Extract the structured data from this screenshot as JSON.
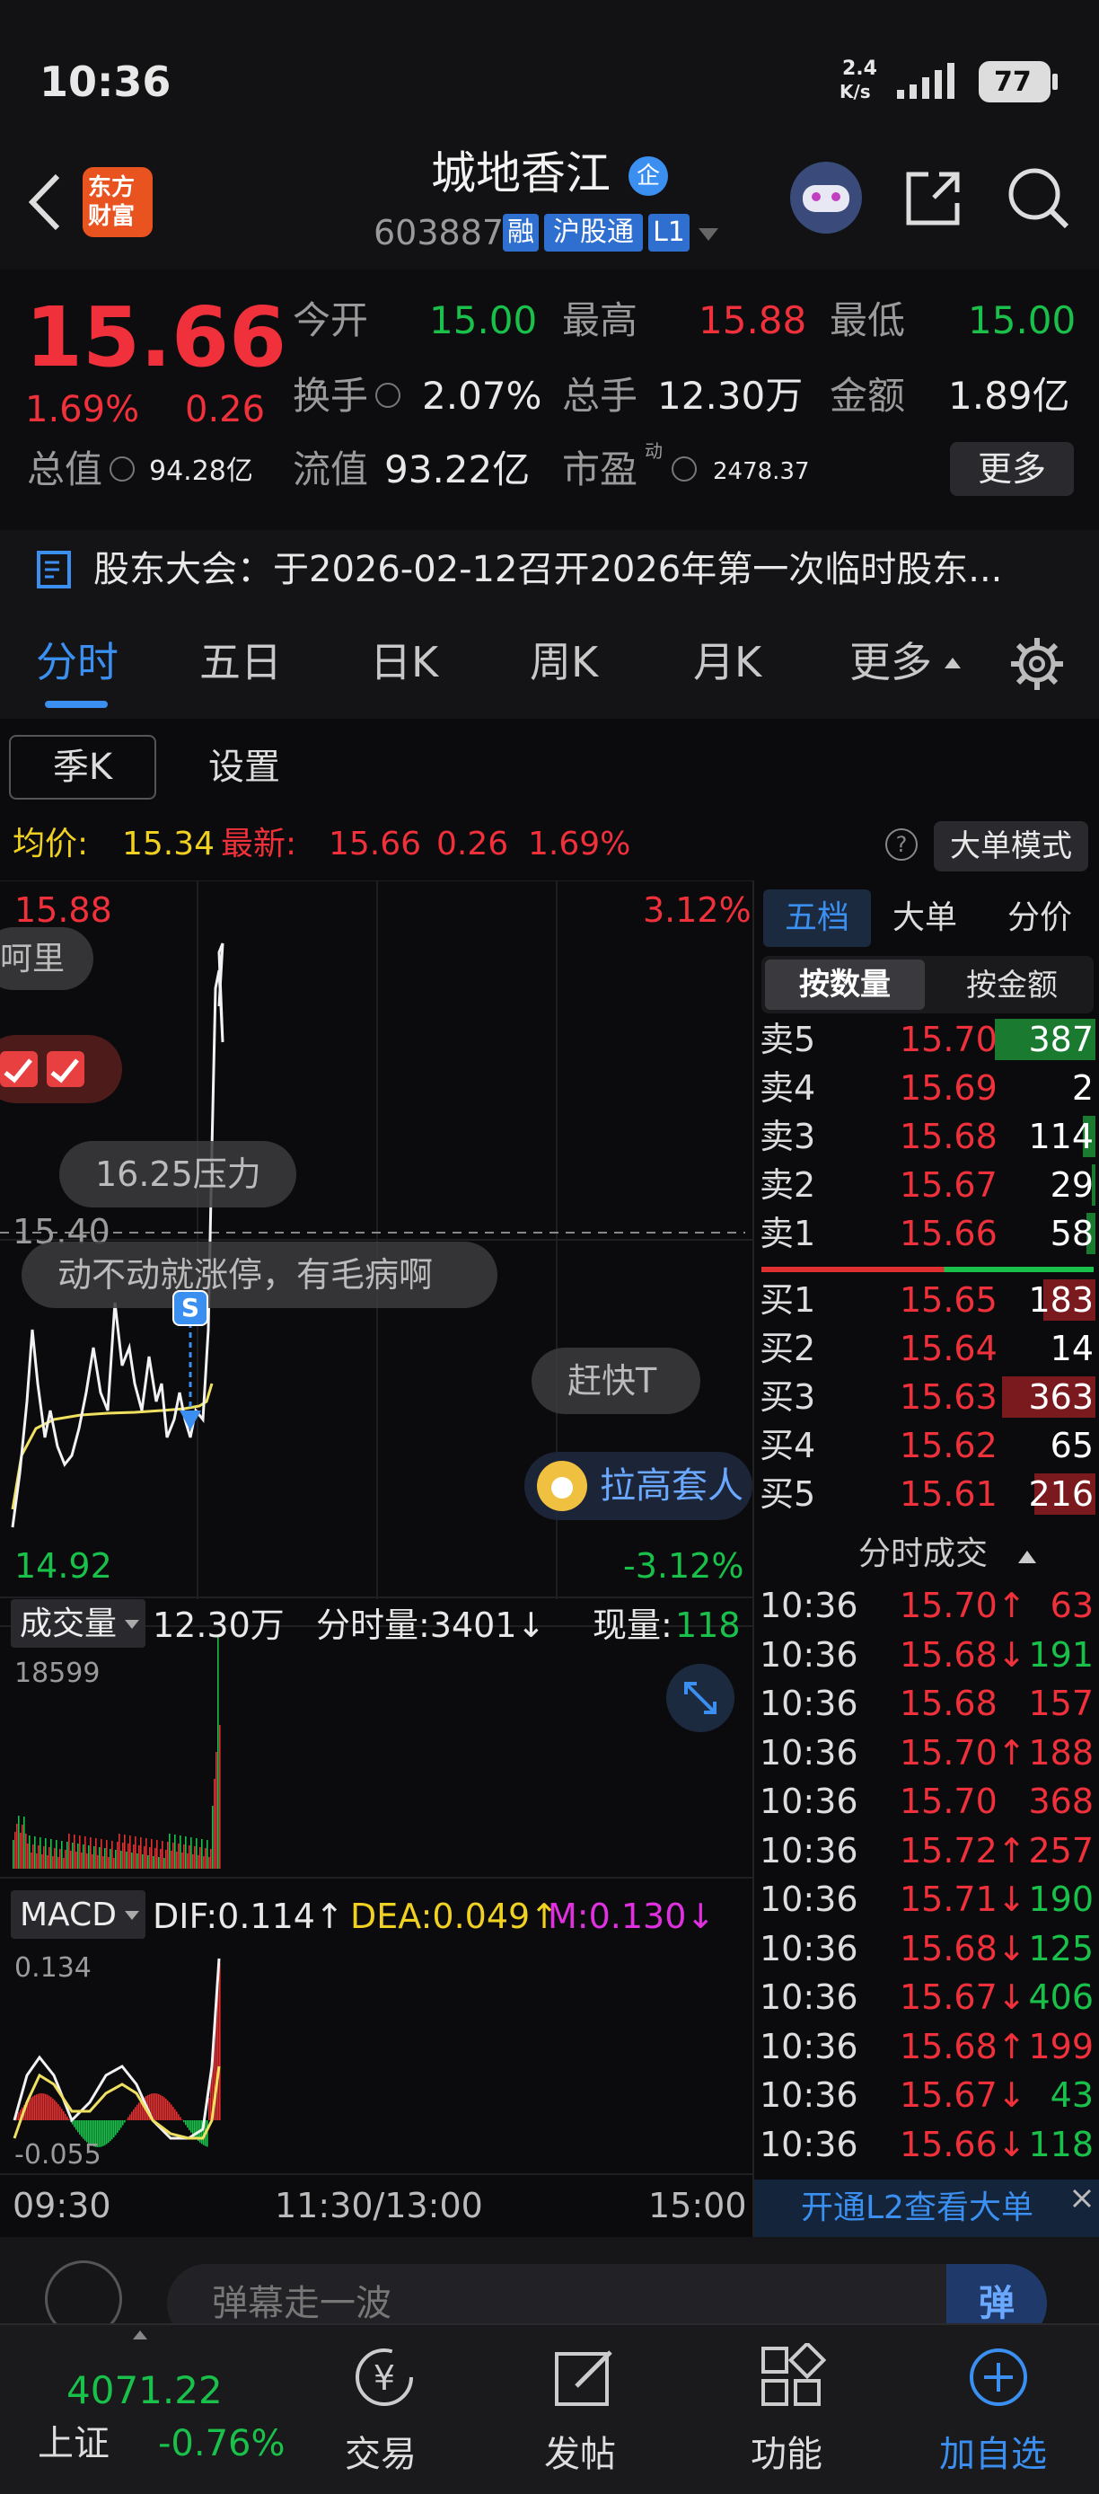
{
  "status": {
    "time": "10:36",
    "net_speed_top": "2.4",
    "net_speed_bottom": "K/s",
    "battery": "77"
  },
  "header": {
    "logo_line1": "东方",
    "logo_line2": "财富",
    "stock_name": "城地香江",
    "qi_badge": "企",
    "stock_code": "603887",
    "tag_rong": "融",
    "tag_hgt": "沪股通",
    "tag_l1": "L1"
  },
  "quote": {
    "price": "15.66",
    "change_pct": "1.69%",
    "change_amt": "0.26",
    "open_label": "今开",
    "open": "15.00",
    "high_label": "最高",
    "high": "15.88",
    "low_label": "最低",
    "low": "15.00",
    "turnover_label": "换手",
    "turnover": "2.07%",
    "volume_label": "总手",
    "volume": "12.30万",
    "amount_label": "金额",
    "amount": "1.89亿",
    "mcap_label": "总值",
    "mcap": "94.28亿",
    "float_label": "流值",
    "float_mcap": "93.22亿",
    "pe_label": "市盈",
    "pe_sup": "动",
    "pe": "2478.37",
    "more_btn": "更多"
  },
  "notice": {
    "text": "股东大会：于2026-02-12召开2026年第一次临时股东..."
  },
  "tabs": [
    "分时",
    "五日",
    "日K",
    "周K",
    "月K",
    "更多"
  ],
  "subtabs": {
    "quarter_k": "季K",
    "settings": "设置"
  },
  "avgline": {
    "avg_label": "均价:",
    "avg": "15.34",
    "latest_label": "最新:",
    "latest": "15.66",
    "chg": "0.26",
    "pct": "1.69%",
    "help": "?",
    "big_order_mode": "大单模式"
  },
  "chart": {
    "top_price": "15.88",
    "top_pct": "3.12%",
    "mid_price": "15.40",
    "bottom_price": "14.92",
    "bottom_pct": "-3.12%",
    "danmaku": [
      "呵里",
      "16.25压力",
      "动不动就涨停，有毛病啊",
      "赶快T"
    ],
    "s_marker": "S",
    "promo": "拉高套人",
    "vol_label": "成交量",
    "vol_total": "12.30万",
    "vol_tick_label": "分时量:3401↓",
    "vol_now_label": "现量:",
    "vol_now": "118",
    "vol_max": "18599",
    "macd_label": "MACD",
    "dif": "DIF:0.114↑",
    "dea": "DEA:0.049↑",
    "m": "M:0.130↓",
    "macd_top": "0.134",
    "macd_bottom": "-0.055",
    "time_start": "09:30",
    "time_mid": "11:30/13:00",
    "time_end": "15:00"
  },
  "orderbook": {
    "tab_five": "五档",
    "tab_big": "大单",
    "tab_price": "分价",
    "by_qty": "按数量",
    "by_amt": "按金额",
    "asks": [
      {
        "label": "卖5",
        "price": "15.70",
        "qty": "387"
      },
      {
        "label": "卖4",
        "price": "15.69",
        "qty": "2"
      },
      {
        "label": "卖3",
        "price": "15.68",
        "qty": "114"
      },
      {
        "label": "卖2",
        "price": "15.67",
        "qty": "29"
      },
      {
        "label": "卖1",
        "price": "15.66",
        "qty": "58"
      }
    ],
    "bids": [
      {
        "label": "买1",
        "price": "15.65",
        "qty": "183"
      },
      {
        "label": "买2",
        "price": "15.64",
        "qty": "14"
      },
      {
        "label": "买3",
        "price": "15.63",
        "qty": "363"
      },
      {
        "label": "买4",
        "price": "15.62",
        "qty": "65"
      },
      {
        "label": "买5",
        "price": "15.61",
        "qty": "216"
      }
    ],
    "trades_title": "分时成交",
    "trades": [
      {
        "time": "10:36",
        "price": "15.70↑",
        "qty": "63",
        "dir": "up"
      },
      {
        "time": "10:36",
        "price": "15.68↓",
        "qty": "191",
        "dir": "down"
      },
      {
        "time": "10:36",
        "price": "15.68",
        "qty": "157",
        "dir": "none"
      },
      {
        "time": "10:36",
        "price": "15.70↑",
        "qty": "188",
        "dir": "up"
      },
      {
        "time": "10:36",
        "price": "15.70",
        "qty": "368",
        "dir": "none"
      },
      {
        "time": "10:36",
        "price": "15.72↑",
        "qty": "257",
        "dir": "up"
      },
      {
        "time": "10:36",
        "price": "15.71↓",
        "qty": "190",
        "dir": "down"
      },
      {
        "time": "10:36",
        "price": "15.68↓",
        "qty": "125",
        "dir": "down"
      },
      {
        "time": "10:36",
        "price": "15.67↓",
        "qty": "406",
        "dir": "down"
      },
      {
        "time": "10:36",
        "price": "15.68↑",
        "qty": "199",
        "dir": "up"
      },
      {
        "time": "10:36",
        "price": "15.67↓",
        "qty": "43",
        "dir": "down"
      },
      {
        "time": "10:36",
        "price": "15.66↓",
        "qty": "118",
        "dir": "down"
      }
    ],
    "l2_banner": "开通L2查看大单"
  },
  "bottom": {
    "danmaku_placeholder": "弹幕走一波",
    "danmaku_btn": "弹",
    "index_value": "4071.22",
    "index_name": "上证",
    "index_pct": "-0.76%",
    "nav": [
      "交易",
      "发帖",
      "功能",
      "加自选"
    ]
  },
  "colors": {
    "up": "#f0303a",
    "down": "#19c14a",
    "accent": "#3a8ff0",
    "bg": "#0b0b0d"
  }
}
